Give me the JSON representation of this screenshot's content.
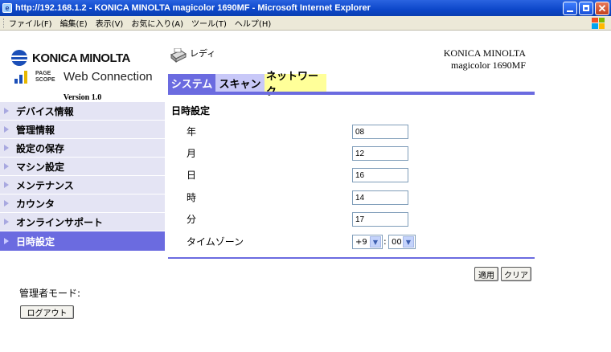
{
  "window": {
    "title": "http://192.168.1.2 - KONICA MINOLTA magicolor 1690MF - Microsoft Internet Explorer"
  },
  "menu": [
    "ファイル(F)",
    "編集(E)",
    "表示(V)",
    "お気に入り(A)",
    "ツール(T)",
    "ヘルプ(H)"
  ],
  "logo": {
    "brand": "KONICA MINOLTA",
    "pagescope_small": "PAGE SCOPE",
    "product": "Web Connection",
    "version": "Version 1.0"
  },
  "nav": [
    {
      "label": "デバイス情報"
    },
    {
      "label": "管理情報"
    },
    {
      "label": "設定の保存"
    },
    {
      "label": "マシン設定"
    },
    {
      "label": "メンテナンス"
    },
    {
      "label": "カウンタ"
    },
    {
      "label": "オンラインサポート"
    },
    {
      "label": "日時設定",
      "active": true
    }
  ],
  "admin": {
    "mode_label": "管理者モード:",
    "logout_label": "ログアウト"
  },
  "header": {
    "status": "レディ",
    "brand_line1": "KONICA MINOLTA",
    "brand_line2": "magicolor 1690MF"
  },
  "tabs": [
    "システム",
    "スキャン",
    "ネットワーク"
  ],
  "form": {
    "title": "日時設定",
    "fields": [
      {
        "label": "年",
        "value": "08"
      },
      {
        "label": "月",
        "value": "12"
      },
      {
        "label": "日",
        "value": "16"
      },
      {
        "label": "時",
        "value": "14"
      },
      {
        "label": "分",
        "value": "17"
      }
    ],
    "timezone": {
      "label": "タイムゾーン",
      "hour": "+9",
      "minute": "00",
      "separator": ":"
    },
    "apply_label": "適用",
    "clear_label": "クリア"
  },
  "colors": {
    "accent": "#6b6be0",
    "nav_bg": "#e4e4f4",
    "tab_scan": "#c8c8f8",
    "tab_network": "#ffff99"
  }
}
